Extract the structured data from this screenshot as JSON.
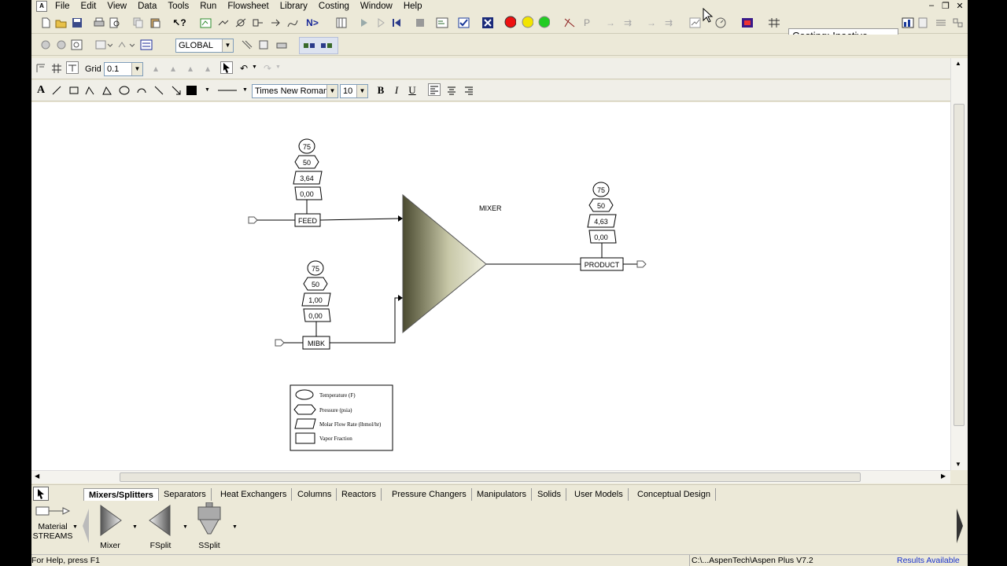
{
  "menubar": {
    "items": [
      "File",
      "Edit",
      "View",
      "Data",
      "Tools",
      "Run",
      "Flowsheet",
      "Library",
      "Costing",
      "Window",
      "Help"
    ]
  },
  "toolbar": {
    "flow_button_label": "N>",
    "costing_status": "Costing: Inactive",
    "section_select": "GLOBAL"
  },
  "drawing_toolbar": {
    "grid_label": "Grid",
    "grid_value": "0.1",
    "font_name": "Times New Roman",
    "font_size": "10",
    "bold_label": "B",
    "italic_label": "I",
    "underline_label": "U",
    "text_tool_label": "A"
  },
  "flowsheet": {
    "mixer_label": "MIXER",
    "streams": [
      {
        "name": "FEED",
        "temperature": "75",
        "pressure": "50",
        "molar_flow": "3,64",
        "vapor_fraction": "0,00"
      },
      {
        "name": "MIBK",
        "temperature": "75",
        "pressure": "50",
        "molar_flow": "1,00",
        "vapor_fraction": "0,00"
      },
      {
        "name": "PRODUCT",
        "temperature": "75",
        "pressure": "50",
        "molar_flow": "4,63",
        "vapor_fraction": "0,00"
      }
    ],
    "legend": [
      {
        "shape": "ellipse",
        "label": "Temperature (F)"
      },
      {
        "shape": "hexagon",
        "label": "Pressure (psia)"
      },
      {
        "shape": "parallelogram",
        "label": "Molar Flow Rate (lbmol/hr)"
      },
      {
        "shape": "rectangle",
        "label": "Vapor Fraction"
      }
    ]
  },
  "palette": {
    "tabs": [
      "Mixers/Splitters",
      "Separators",
      "Heat Exchangers",
      "Columns",
      "Reactors",
      "Pressure Changers",
      "Manipulators",
      "Solids",
      "User Models",
      "Conceptual Design"
    ],
    "active_tab": "Mixers/Splitters",
    "models": [
      {
        "label": "Material"
      },
      {
        "label": "STREAMS"
      },
      {
        "label": "Mixer"
      },
      {
        "label": "FSplit"
      },
      {
        "label": "SSplit"
      }
    ]
  },
  "statusbar": {
    "help": "For Help, press F1",
    "path": "C:\\...AspenTech\\Aspen Plus V7.2",
    "results": "Results Available"
  },
  "colors": {
    "results_available": "#1a33cc",
    "stop_red": "#ee1111",
    "pause_yellow": "#f2e400",
    "go_green": "#22cc22"
  }
}
